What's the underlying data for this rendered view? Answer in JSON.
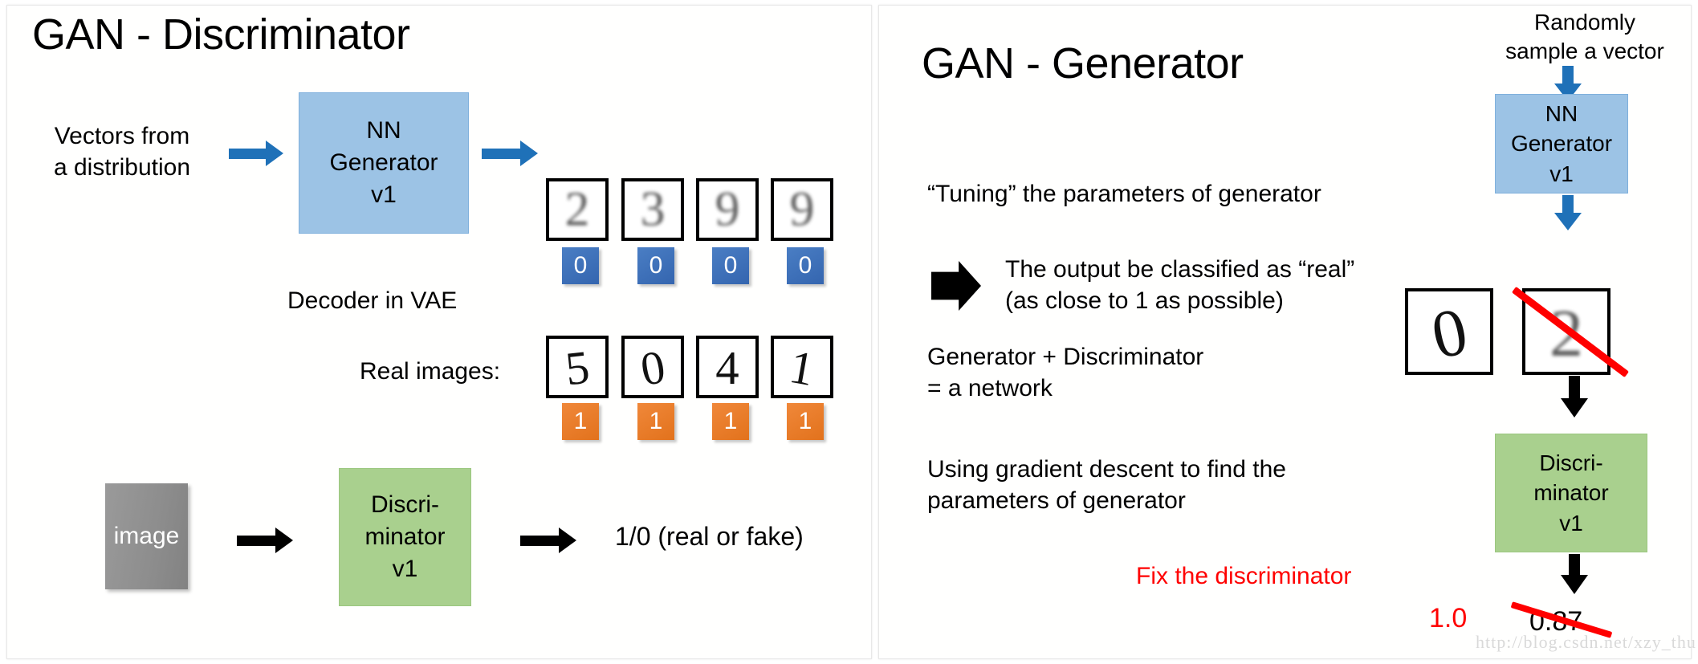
{
  "left_panel": {
    "title": "GAN - Discriminator",
    "input_label": "Vectors from\na distribution",
    "generator_box": {
      "line1": "NN",
      "line2": "Generator",
      "line3": "v1"
    },
    "generator_caption": "Decoder in VAE",
    "generated_row": {
      "digits": [
        "2",
        "3",
        "9",
        "9"
      ],
      "labels": [
        "0",
        "0",
        "0",
        "0"
      ],
      "label_color": "#3465AF"
    },
    "real_row": {
      "caption": "Real images:",
      "digits": [
        "5",
        "0",
        "4",
        "1"
      ],
      "labels": [
        "1",
        "1",
        "1",
        "1"
      ],
      "label_color": "#E2721C"
    },
    "image_block": "image",
    "discriminator_box": {
      "line1": "Discri-",
      "line2": "minator",
      "line3": "v1"
    },
    "output_text": "1/0  (real or fake)"
  },
  "right_panel": {
    "title": "GAN - Generator",
    "tuning_text": "“Tuning” the parameters of generator",
    "bullet_line1": "The output be classified as “real”",
    "bullet_line2": "(as close to 1 as possible)",
    "network_line1": "Generator + Discriminator",
    "network_line2": "= a network",
    "gradient_line1": "Using gradient descent to find the",
    "gradient_line2": "parameters of generator",
    "fix_note": "Fix the discriminator",
    "fix_note_color": "#FF0000"
  },
  "flow_column": {
    "sample_caption": "Randomly\nsample a vector",
    "generator_box": {
      "line1": "NN",
      "line2": "Generator",
      "line3": "v1"
    },
    "target_digit": "0",
    "generated_digit": "2",
    "discriminator_box": {
      "line1": "Discri-",
      "line2": "minator",
      "line3": "v1"
    },
    "target_score": "1.0",
    "current_score": "0.87",
    "target_score_color": "#FF0000"
  },
  "watermark": "http://blog.csdn.net/xzy_thu"
}
